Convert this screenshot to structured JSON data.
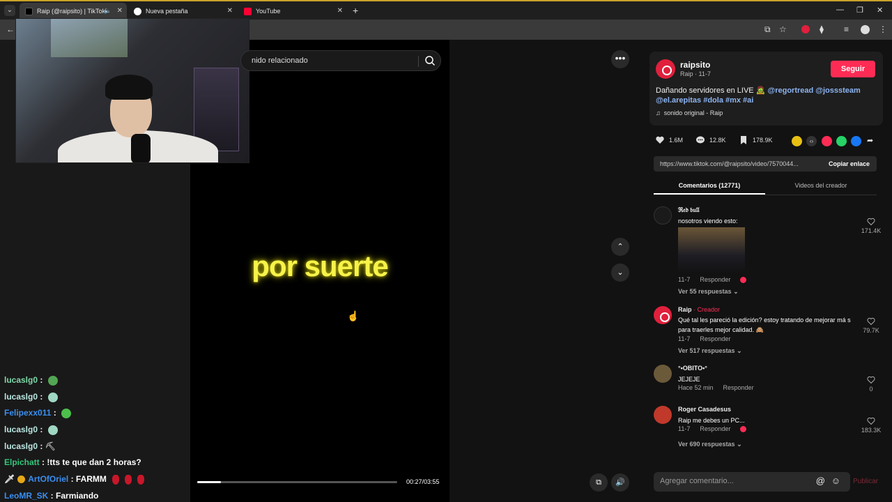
{
  "browser": {
    "tabs": [
      {
        "title": "Raip (@raipsito) | TikTok"
      },
      {
        "title": "Nueva pestaña"
      },
      {
        "title": "YouTube"
      }
    ]
  },
  "video": {
    "search_text": "nido relacionado",
    "caption": "por suerte",
    "time": "00:27/03:55",
    "progress": 0.12
  },
  "chat": [
    {
      "user": "lucaslg0",
      "color": "#7fd8a8",
      "msg": ""
    },
    {
      "user": "lucaslg0",
      "color": "#b9e6e0",
      "msg": ""
    },
    {
      "user": "Felipexx011",
      "color": "#3a8ff2",
      "msg": ""
    },
    {
      "user": "lucaslg0",
      "color": "#b9e6e0",
      "msg": ""
    },
    {
      "user": "lucaslg0",
      "color": "#b9e6e0",
      "msg": ""
    },
    {
      "user": "Elpichatt",
      "color": "#32c67a",
      "msg": "!tts te que dan 2 horas?"
    },
    {
      "user": "ArtOfOriel",
      "color": "#3a8ff2",
      "msg": "FARMM"
    },
    {
      "user": "LeoMR_SK",
      "color": "#3a8ff2",
      "msg": "Farmiando"
    }
  ],
  "author": {
    "name": "raipsito",
    "sub": "Raip · 11-7",
    "follow": "Seguir",
    "desc_text": "Dañando servidores en LIVE 🧟",
    "desc_tags": "@regortread @josssteam @el.arepitas #dola #mx #ai",
    "music": "sonido original - Raip"
  },
  "stats": {
    "likes": "1.6M",
    "comments": "12.8K",
    "saves": "178.9K"
  },
  "link": {
    "url": "https://www.tiktok.com/@raipsito/video/7570044...",
    "copy": "Copiar enlace"
  },
  "tabs": {
    "comments": "Comentarios (12771)",
    "videos": "Videos del creador"
  },
  "comments": [
    {
      "name": "ℜ𝔢𝔡 𝔟𝔲𝔩𝔩",
      "text": "nosotros viendo esto:",
      "date": "11-7",
      "reply": "Responder",
      "more": "Ver 55 respuestas",
      "likes": "171.4K"
    },
    {
      "name": "Raip",
      "creator": "· Creador",
      "text": "Qué tal les pareció la edición? estoy tratando de mejorar má s para traerles mejor calidad. 🙈",
      "date": "11-7",
      "reply": "Responder",
      "more": "Ver 517 respuestas",
      "likes": "79.7K"
    },
    {
      "name": "°•OBITO•°",
      "text": "JEJEJE",
      "date": "Hace 52 min",
      "reply": "Responder",
      "likes": "0"
    },
    {
      "name": "Roger Casadesus",
      "text": "Raip me debes un PC...",
      "date": "11-7",
      "reply": "Responder",
      "more": "Ver 690 respuestas",
      "likes": "183.3K"
    }
  ],
  "input": {
    "placeholder": "Agregar comentario...",
    "publish": "Publicar"
  },
  "colors": {
    "accent": "#fe2c55",
    "caption": "#f7f34a"
  }
}
